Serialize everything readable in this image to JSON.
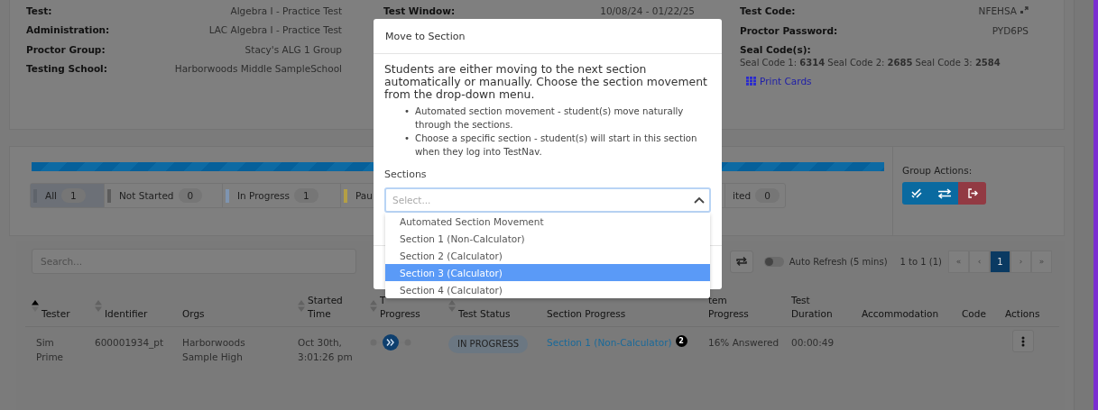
{
  "info": {
    "left": [
      {
        "label": "Test:",
        "value": "Algebra I - Practice Test"
      },
      {
        "label": "Administration:",
        "value": "LAC Algebra I - Practice Test"
      },
      {
        "label": "Proctor Group:",
        "value": "Stacy's ALG 1 Group"
      },
      {
        "label": "Testing School:",
        "value": "Harborwoods Middle SampleSchool"
      }
    ],
    "middle": [
      {
        "label": "Test Window:",
        "value": "10/08/24 - 01/22/25"
      }
    ],
    "test_code": {
      "label": "Test Code:",
      "value": "NFEHSA"
    },
    "proctor_password": {
      "label": "Proctor Password:",
      "value": "PYD6PS"
    },
    "seal_codes": {
      "label": "Seal Code(s):",
      "text": "Seal Code 1: **6314** Seal Code 2: **2685** Seal Code 3: **2584**"
    },
    "print_cards": "Print Cards"
  },
  "progress_bar": {
    "level": 1
  },
  "filters": [
    {
      "label": "All",
      "count": "1",
      "selected": true,
      "color": "#5f646b"
    },
    {
      "label": "Not Started",
      "count": "0",
      "selected": false,
      "color": "#5c5c5c"
    },
    {
      "label": "In Progress",
      "count": "1",
      "selected": false,
      "color": "#7e94b0"
    },
    {
      "label": "Pau",
      "selected": false,
      "color": "#b49f45"
    },
    {
      "label": "ited",
      "count": "0",
      "selected": false
    }
  ],
  "group_actions": {
    "label": "Group Actions:",
    "buttons": [
      {
        "kind": "mark"
      },
      {
        "kind": "move"
      },
      {
        "kind": "exit"
      }
    ]
  },
  "toolbar": {
    "search_placeholder": "Search...",
    "auto_refresh": {
      "label": "Auto Refresh (5 mins)",
      "on": false
    },
    "range": "1 to 1 (1)",
    "pages": [
      {
        "label": "«",
        "selected": false
      },
      {
        "label": "‹",
        "selected": false
      },
      {
        "label": "1",
        "selected": true
      },
      {
        "label": "›",
        "selected": false
      },
      {
        "label": "»",
        "selected": false
      }
    ]
  },
  "table": {
    "columns": [
      {
        "lines": [
          "Tester"
        ],
        "sorted": true
      },
      {
        "lines": [
          "Identifier"
        ],
        "sorted": false
      },
      {
        "lines": [
          "Orgs"
        ]
      },
      {
        "lines": [
          "Started",
          "Time"
        ],
        "sorted": false
      },
      {
        "lines": [
          "T",
          "Progress"
        ],
        "sorted": false
      },
      {
        "lines": [
          "Test Status"
        ],
        "sorted": false
      },
      {
        "lines": [
          "Section Progress"
        ]
      },
      {
        "lines": [
          "tem",
          "Progress"
        ]
      },
      {
        "lines": [
          "Test",
          "Duration"
        ]
      },
      {
        "lines": [
          "Accommodation"
        ]
      },
      {
        "lines": [
          "Code"
        ]
      },
      {
        "lines": [
          "Actions"
        ]
      }
    ],
    "rows": [
      {
        "tester": [
          "Sim",
          "Prime"
        ],
        "identifier": "600001934_pt",
        "orgs": [
          "Harborwoods",
          "Sample High"
        ],
        "started": [
          "Oct 30th,",
          "3:01:26 pm"
        ],
        "status": "IN PROGRESS",
        "section": "Section 1 (Non-Calculator)",
        "section_badge": "2",
        "item_progress": "16% Answered",
        "duration": "00:00:49"
      }
    ]
  },
  "modal": {
    "title": "Move to Section",
    "intro": "Students are either moving to the next section automatically or manually. Choose the section movement from the drop-down menu.",
    "bullet_marker": "•",
    "bullets": [
      "Automated section movement - student(s) move naturally through the sections.",
      "Choose a specific section - student(s) will start in this section when they log into TestNav."
    ],
    "sections_label": "Sections",
    "select": {
      "placeholder": "Select...",
      "expanded": true,
      "options": [
        {
          "label": "Automated Section Movement",
          "selected": false
        },
        {
          "label": "Section 1 (Non-Calculator)",
          "selected": false
        },
        {
          "label": "Section 2 (Calculator)",
          "selected": false
        },
        {
          "label": "Section 3 (Calculator)",
          "selected": true
        },
        {
          "label": "Section 4 (Calculator)",
          "selected": false
        }
      ]
    }
  }
}
